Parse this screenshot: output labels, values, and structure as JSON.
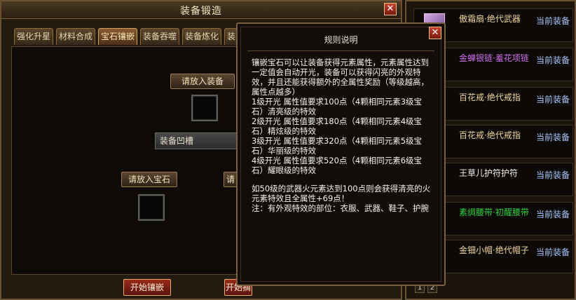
{
  "forge": {
    "title": "装备锻造",
    "tabs": [
      "强化升星",
      "材料合成",
      "宝石镶嵌",
      "装备吞噬",
      "装备炼化",
      "装"
    ],
    "active_tab": 2,
    "place_equipment_label": "请放入装备",
    "groove_label": "装备凹槽",
    "place_gem_label": "请放入宝石",
    "place_gem_label_partial": "请",
    "start_inlay_label": "开始镶嵌",
    "start_remove_label": "开始摘除"
  },
  "rules": {
    "title": "规则说明",
    "lines": [
      "镶嵌宝石可以让装备获得元素属性，元素属性达到一定值会自动开光，装备可以获得闪亮的外观特效，并且还能获得额外的全属性奖励（等级越高，属性点越多）",
      "1级开光  属性值要求100点（4颗相同元素3级宝石）清亮级的特效",
      "2级开光  属性值要求180点（4颗相同元素4级宝石）精炫级的特效",
      "3级开光  属性值要求320点（4颗相同元素5级宝石）华丽级的特效",
      "4级开光  属性值要求520点（4颗相同元素6级宝石）耀眼级的特效",
      "",
      "如50级的武器火元素达到100点则会获得清亮的火元素特效且全属性+69点！",
      "注：有外观特效的部位：衣服、武器、鞋子、护腕"
    ]
  },
  "equipment": {
    "items": [
      {
        "name": "傲霜扇·绝代武器",
        "status": "当前装备",
        "color": "#f0d8a0",
        "icon": "fan-icon"
      },
      {
        "name": "金蝉银链·羞花项链",
        "status": "当前装备",
        "color": "#d070f0",
        "icon": "necklace-icon"
      },
      {
        "name": "百花戒·绝代戒指",
        "status": "当前装备",
        "color": "#f0d8a0",
        "icon": "ring-icon"
      },
      {
        "name": "百花戒·绝代戒指",
        "status": "当前装备",
        "color": "#f0d8a0",
        "icon": "ring-icon"
      },
      {
        "name": "王草儿护符护符",
        "status": "当前装备",
        "color": "#f2f2f2",
        "icon": "amulet-icon"
      },
      {
        "name": "素绸腰带·初醒腰带",
        "status": "当前装备",
        "color": "#30d040",
        "icon": "belt-icon"
      },
      {
        "name": "金钿小帽·绝代帽子",
        "status": "当前装备",
        "color": "#f0d8a0",
        "icon": "hat-icon"
      }
    ],
    "pages": [
      "1",
      "2"
    ]
  }
}
